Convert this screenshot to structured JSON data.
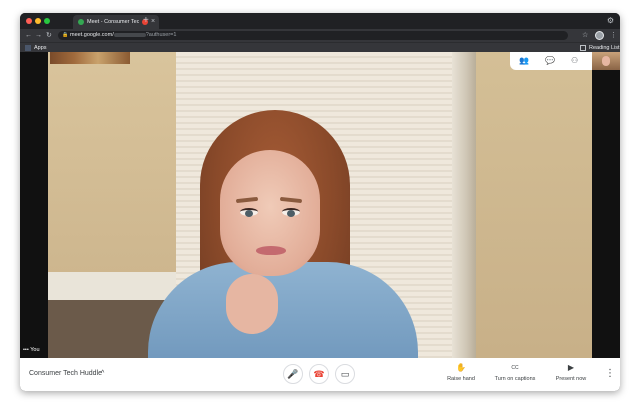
{
  "browser": {
    "tab_title": "Meet - Consumer Tech Hu",
    "tab_close": "×",
    "new_tab": "+",
    "url_host": "meet.google.com/",
    "url_suffix": "?authuser=1",
    "bookmarks": {
      "apps_label": "Apps",
      "reading_list_label": "Reading List"
    },
    "nav": {
      "back": "←",
      "forward": "→",
      "reload": "↻"
    },
    "star": "☆",
    "menu": "⋮",
    "lock": "🔒",
    "gear": "⚙"
  },
  "meet": {
    "self_label": "You",
    "self_more": "•••",
    "meeting_name": "Consumer Tech Huddle",
    "caret": "^",
    "controls": {
      "mic": "🎤",
      "hangup": "☎",
      "camera": "▭"
    },
    "actions": [
      {
        "label": "Raise hand",
        "icon": "✋"
      },
      {
        "label": "Turn on captions",
        "icon": "CC"
      },
      {
        "label": "Present now",
        "icon": "▶"
      }
    ],
    "more": "⋮",
    "top_icons": {
      "people": "👥",
      "chat": "💬",
      "activities": "⚇"
    }
  },
  "colors": {
    "accent_red": "#ea4335",
    "meet_green": "#34a853"
  },
  "icons": [
    "people-icon",
    "chat-icon",
    "activities-icon",
    "mic-icon",
    "hangup-icon",
    "camera-icon",
    "hand-icon",
    "captions-icon",
    "present-icon",
    "more-vert-icon"
  ]
}
